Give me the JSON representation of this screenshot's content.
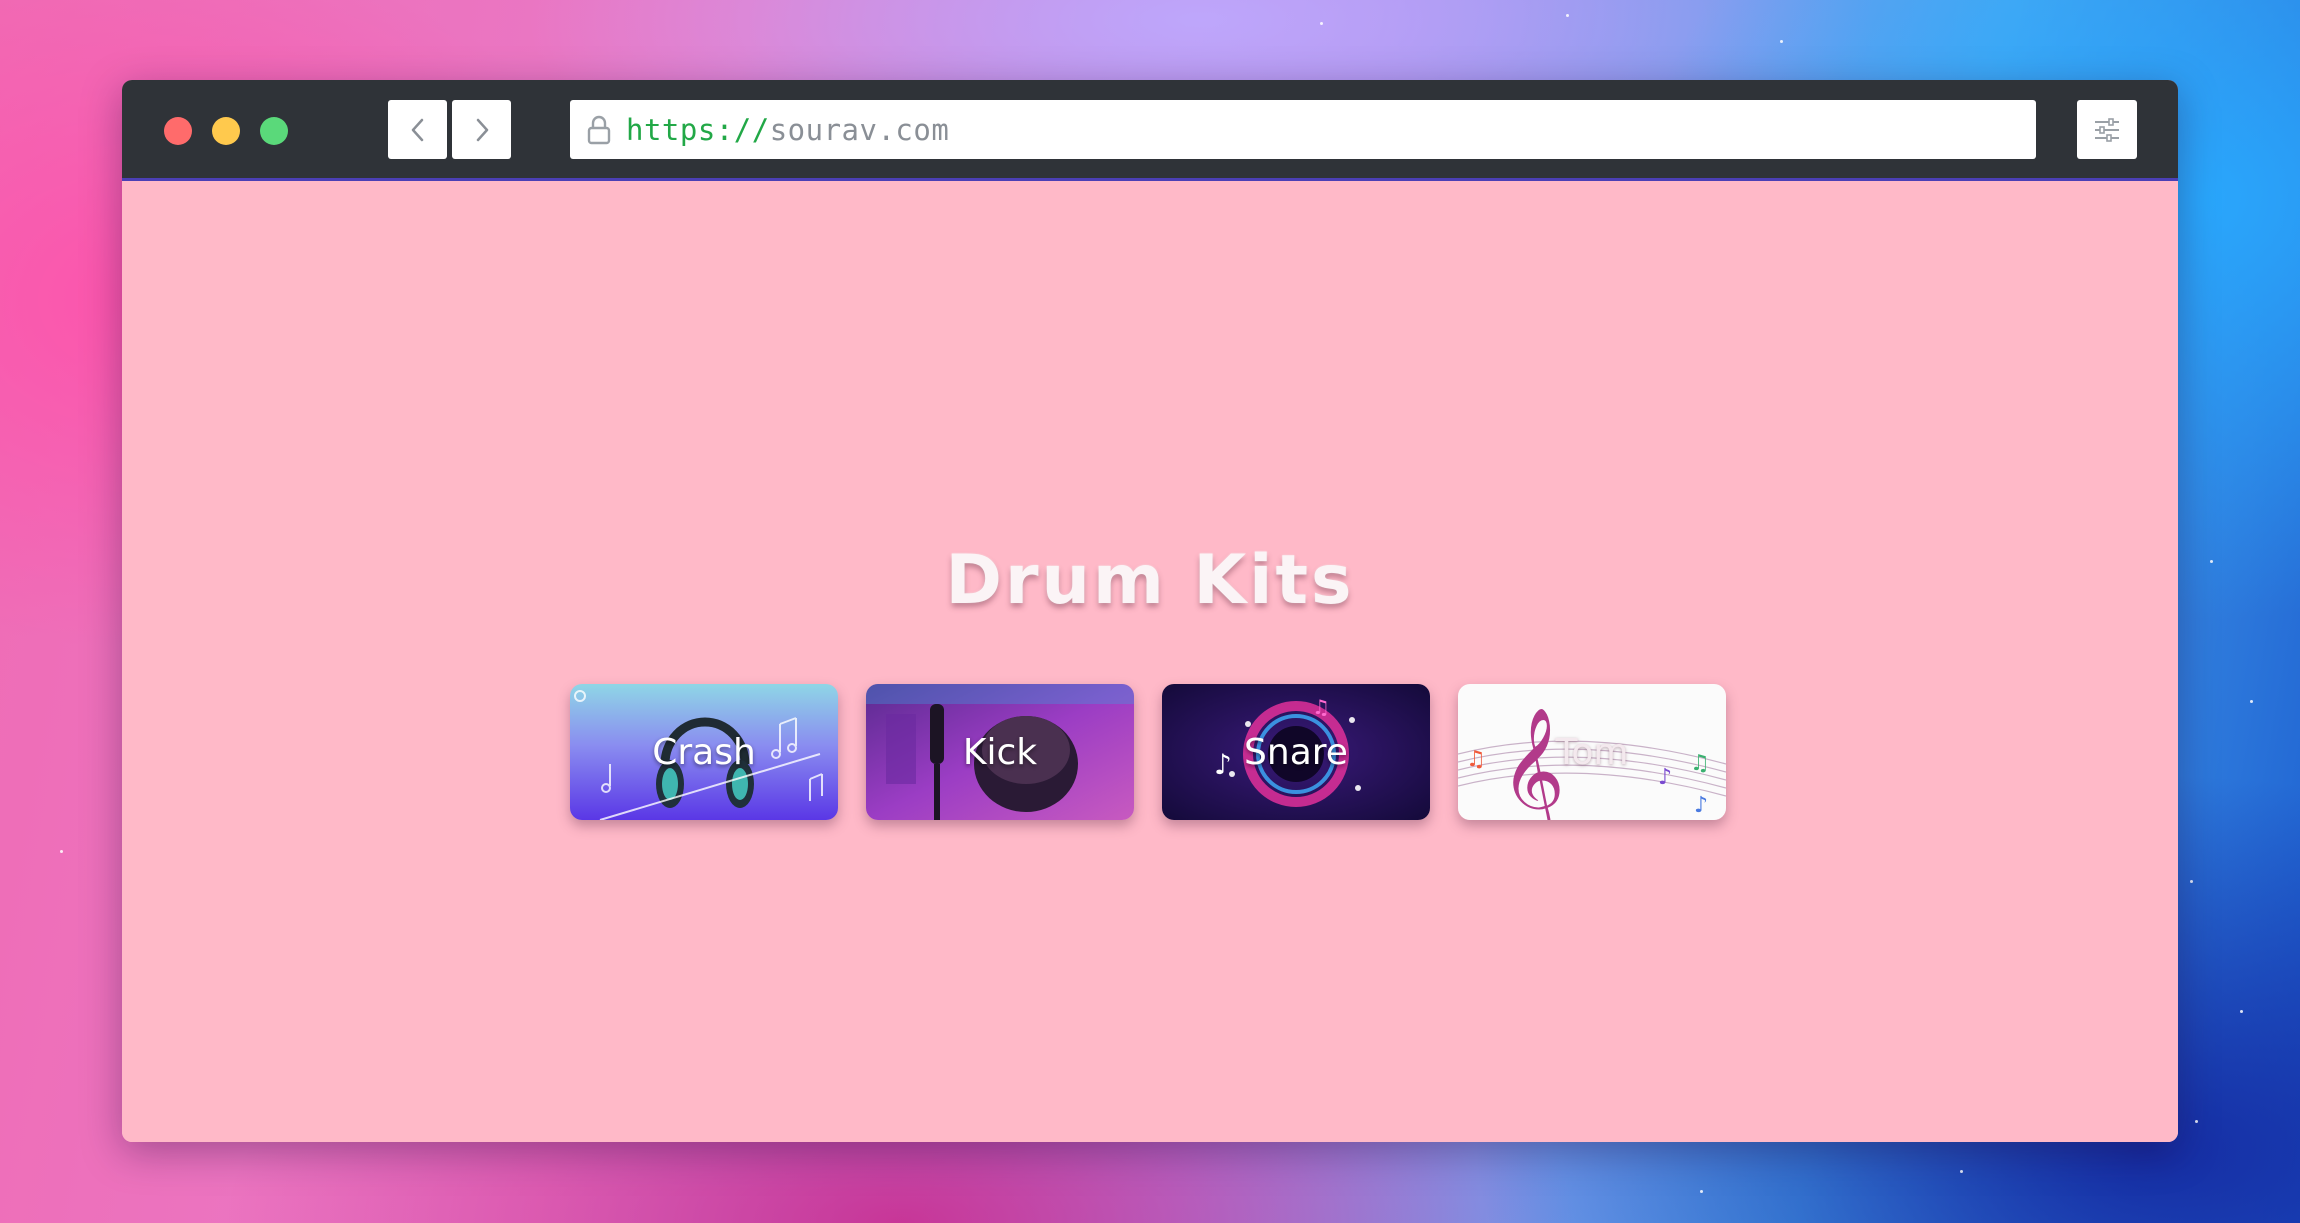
{
  "browser": {
    "url_scheme": "https://",
    "url_host": "sourav.com",
    "back_icon": "chevron-left-icon",
    "forward_icon": "chevron-right-icon",
    "lock_icon": "lock-icon",
    "settings_icon": "sliders-icon"
  },
  "page": {
    "title": "Drum Kits",
    "background_color": "#ffb9c8",
    "kits": [
      {
        "label": "Crash"
      },
      {
        "label": "Kick"
      },
      {
        "label": "Snare"
      },
      {
        "label": "Tom"
      }
    ]
  },
  "colors": {
    "traffic_red": "#ff6b6b",
    "traffic_yellow": "#ffc94d",
    "traffic_green": "#5ad97a",
    "titlebar": "#2f3338",
    "url_scheme": "#22a847",
    "url_host": "#8a8f96"
  }
}
